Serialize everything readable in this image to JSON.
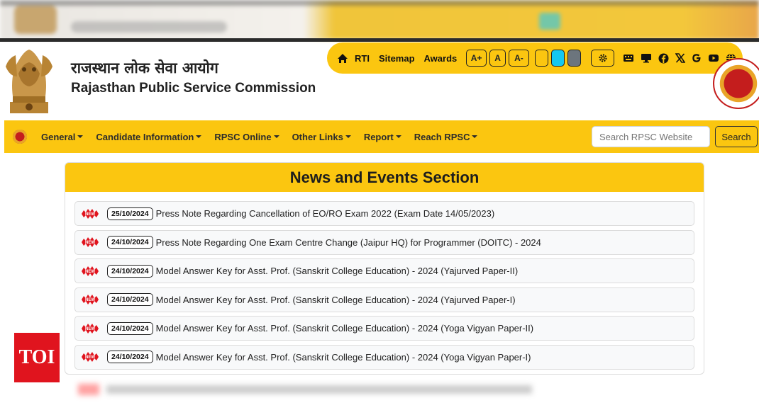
{
  "header": {
    "title_hindi": "राजस्थान लोक सेवा आयोग",
    "title_english": "Rajasthan Public Service Commission"
  },
  "utility_bar": {
    "rti": "RTI",
    "sitemap": "Sitemap",
    "awards": "Awards",
    "font_increase": "A+",
    "font_normal": "A",
    "font_decrease": "A-",
    "theme_colors": [
      "#fbc610",
      "#14c8f0",
      "#6c757d"
    ]
  },
  "nav": {
    "items": [
      {
        "label": "General"
      },
      {
        "label": "Candidate Information"
      },
      {
        "label": "RPSC Online"
      },
      {
        "label": "Other Links"
      },
      {
        "label": "Report"
      },
      {
        "label": "Reach RPSC"
      }
    ],
    "search_placeholder": "Search RPSC Website",
    "search_button": "Search"
  },
  "news": {
    "heading": "News and Events Section",
    "badge_text": "NEW",
    "items": [
      {
        "date": "25/10/2024",
        "text": "Press Note Regarding Cancellation of EO/RO Exam 2022 (Exam Date 14/05/2023)"
      },
      {
        "date": "24/10/2024",
        "text": "Press Note Regarding One Exam Centre Change (Jaipur HQ) for Programmer (DOITC) - 2024"
      },
      {
        "date": "24/10/2024",
        "text": "Model Answer Key for Asst. Prof. (Sanskrit College Education) - 2024 (Yajurved Paper-II)"
      },
      {
        "date": "24/10/2024",
        "text": "Model Answer Key for Asst. Prof. (Sanskrit College Education) - 2024 (Yajurved Paper-I)"
      },
      {
        "date": "24/10/2024",
        "text": "Model Answer Key for Asst. Prof. (Sanskrit College Education) - 2024 (Yoga Vigyan Paper-II)"
      },
      {
        "date": "24/10/2024",
        "text": "Model Answer Key for Asst. Prof. (Sanskrit College Education) - 2024 (Yoga Vigyan Paper-I)"
      }
    ]
  },
  "watermark": "TOI",
  "colors": {
    "accent": "#fbc610",
    "badge_red": "#e0141e"
  }
}
